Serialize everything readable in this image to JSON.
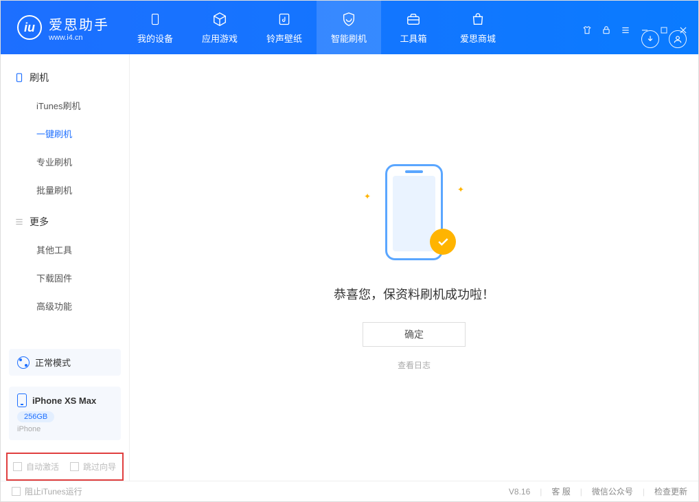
{
  "app": {
    "name": "爱思助手",
    "url": "www.i4.cn"
  },
  "tabs": [
    {
      "label": "我的设备"
    },
    {
      "label": "应用游戏"
    },
    {
      "label": "铃声壁纸"
    },
    {
      "label": "智能刷机"
    },
    {
      "label": "工具箱"
    },
    {
      "label": "爱思商城"
    }
  ],
  "sidebar": {
    "section1": {
      "title": "刷机",
      "items": [
        "iTunes刷机",
        "一键刷机",
        "专业刷机",
        "批量刷机"
      ]
    },
    "section2": {
      "title": "更多",
      "items": [
        "其他工具",
        "下载固件",
        "高级功能"
      ]
    }
  },
  "mode_text": "正常模式",
  "device": {
    "name": "iPhone XS Max",
    "storage": "256GB",
    "type": "iPhone"
  },
  "options": {
    "auto_activate": "自动激活",
    "skip_guide": "跳过向导"
  },
  "main": {
    "success_text": "恭喜您，保资料刷机成功啦！",
    "ok_label": "确定",
    "log_link": "查看日志"
  },
  "footer": {
    "block_itunes": "阻止iTunes运行",
    "version": "V8.16",
    "links": [
      "客 服",
      "微信公众号",
      "检查更新"
    ]
  }
}
